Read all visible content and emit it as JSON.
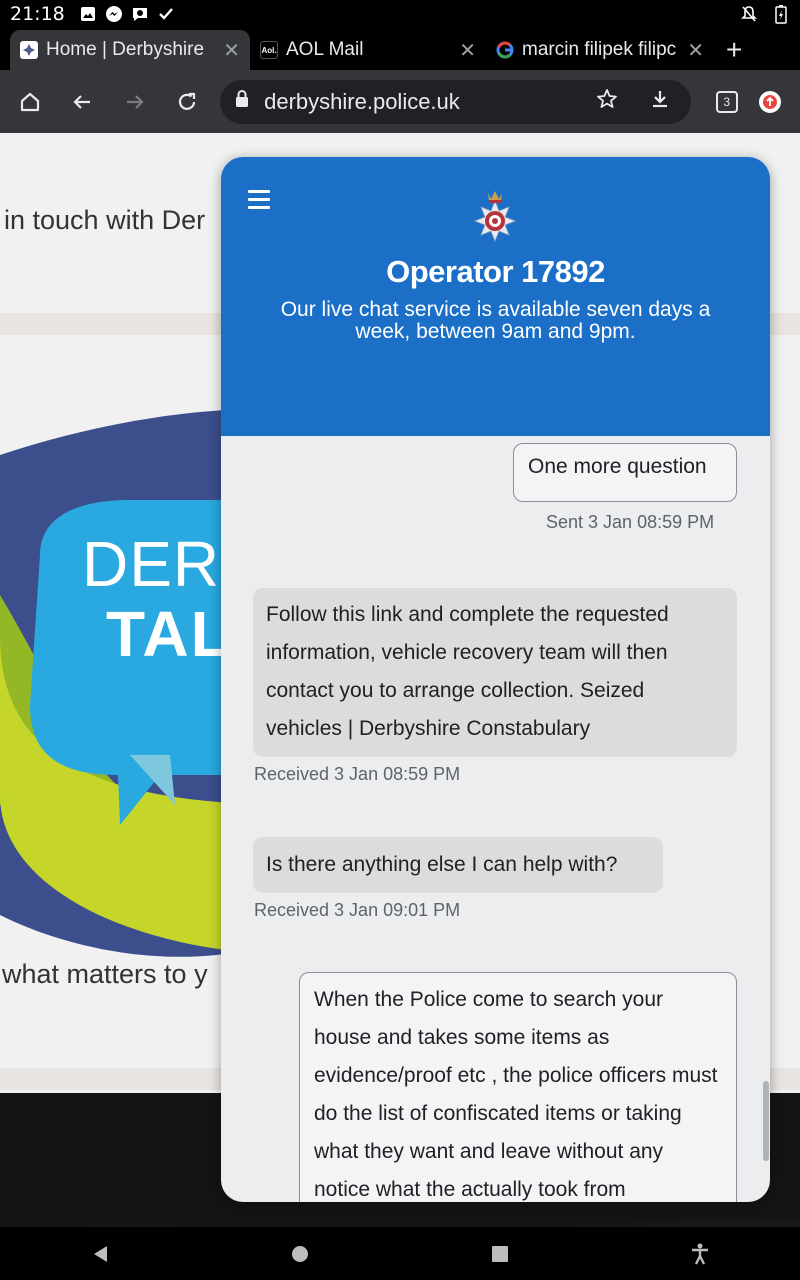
{
  "status": {
    "time": "21:18",
    "icons": [
      "gallery-icon",
      "messenger-icon",
      "chat-bubble-icon",
      "check-icon"
    ],
    "right_icons": [
      "notifications-off-icon",
      "battery-charging-icon"
    ]
  },
  "tabs": [
    {
      "label": "Home | Derbyshire",
      "favicon": "derbyshire-crest",
      "active": true
    },
    {
      "label": "AOL Mail",
      "favicon": "Aol.",
      "active": false
    },
    {
      "label": "marcin filipek filipc",
      "favicon": "google-icon",
      "active": false
    }
  ],
  "toolbar": {
    "url": "derbyshire.police.uk",
    "tab_count": "3"
  },
  "page": {
    "intro_text": "in touch with Der",
    "logo_line1": "DERB",
    "logo_line2": "TAL",
    "matters_text": "what matters to y"
  },
  "chat": {
    "operator": "Operator 17892",
    "availability": "Our live chat service is available seven days a week, between 9am and 9pm.",
    "messages": [
      {
        "type": "sent",
        "text": "One more question",
        "meta": "Sent  3 Jan 08:59 PM"
      },
      {
        "type": "received",
        "text": "Follow this link and complete the requested information, vehicle recovery team will then contact you to arrange collection. Seized vehicles | Derbyshire Constabulary",
        "meta": "Received  3 Jan 08:59 PM"
      },
      {
        "type": "received",
        "text": "Is there anything else I can help with?",
        "meta": "Received  3 Jan 09:01 PM"
      },
      {
        "type": "sent",
        "text": "When the Police come to search your house and takes some items as evidence/proof etc , the police officers must do the list of confiscated items or taking what they want and leave without any notice what the actually took from"
      }
    ]
  },
  "colors": {
    "chat_header": "#1b6fc7",
    "browser_toolbar": "#35363a",
    "chat_background": "#ebedef",
    "received_bubble": "#dcdcdc"
  }
}
